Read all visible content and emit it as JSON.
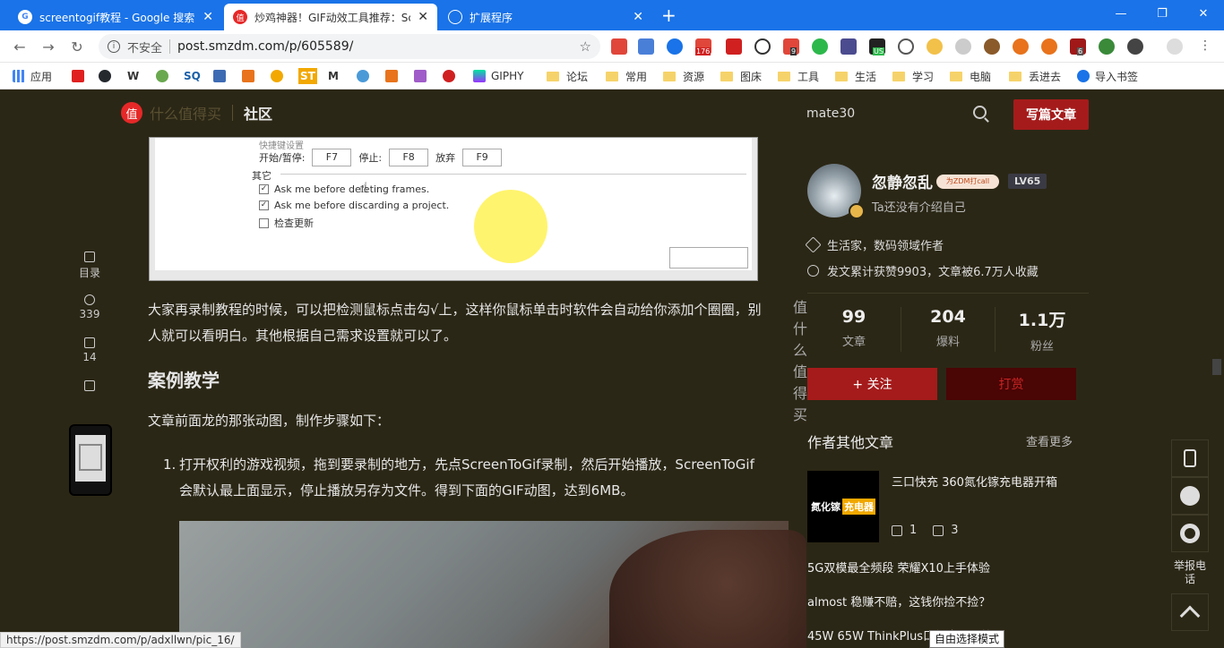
{
  "browser": {
    "tabs": [
      {
        "title": "screentogif教程 - Google 搜索",
        "favicon_color": "#4285f4",
        "icon": "google-icon"
      },
      {
        "title": "炒鸡神器！GIF动效工具推荐：Sc",
        "favicon_color": "#e62828",
        "icon": "smzdm-icon"
      },
      {
        "title": "扩展程序",
        "favicon_color": "#1a73e8",
        "icon": "puzzle-icon"
      }
    ],
    "new_tab_label": "+",
    "close_label": "✕",
    "window_controls": [
      "—",
      "❐",
      "✕"
    ]
  },
  "toolbar": {
    "security_label": "不安全",
    "url": "post.smzdm.com/p/605589/",
    "info_icon": "i",
    "star": "☆"
  },
  "bookmarks": [
    {
      "label": "应用",
      "type": "apps"
    },
    {
      "label": "",
      "type": "icon",
      "color": "#e02020"
    },
    {
      "label": "",
      "type": "icon",
      "color": "#24292e"
    },
    {
      "label": "W",
      "type": "text"
    },
    {
      "label": "",
      "type": "icon",
      "color": "#6aa84f"
    },
    {
      "label": "SQ",
      "type": "text"
    },
    {
      "label": "",
      "type": "icon",
      "color": "#3d6bb3"
    },
    {
      "label": "",
      "type": "icon",
      "color": "#e8731c"
    },
    {
      "label": "",
      "type": "icon",
      "color": "#f2a800"
    },
    {
      "label": "ST",
      "type": "text"
    },
    {
      "label": "M",
      "type": "text"
    },
    {
      "label": "",
      "type": "icon",
      "color": "#4a9ad8"
    },
    {
      "label": "",
      "type": "icon",
      "color": "#e8731c"
    },
    {
      "label": "",
      "type": "icon",
      "color": "#a05cc8"
    },
    {
      "label": "",
      "type": "icon",
      "color": "#d02020"
    },
    {
      "label": "GIPHY",
      "type": "text"
    },
    {
      "label": "论坛",
      "type": "folder"
    },
    {
      "label": "常用",
      "type": "folder"
    },
    {
      "label": "资源",
      "type": "folder"
    },
    {
      "label": "图床",
      "type": "folder"
    },
    {
      "label": "工具",
      "type": "folder"
    },
    {
      "label": "生活",
      "type": "folder"
    },
    {
      "label": "学习",
      "type": "folder"
    },
    {
      "label": "电脑",
      "type": "folder"
    },
    {
      "label": "丢进去",
      "type": "folder"
    },
    {
      "label": "导入书签",
      "type": "gear"
    }
  ],
  "extensions_badges": {
    "e176": "176",
    "e9": "9",
    "eus": "US",
    "e6": "6"
  },
  "site": {
    "logo_mark": "值",
    "logo_name": "什么值得买",
    "community": "社区",
    "search_text": "mate30",
    "write_button": "写篇文章"
  },
  "leftbar": {
    "toc": "目录",
    "favorites": "339",
    "comments": "14"
  },
  "screenshot_inner": {
    "section_title": "快捷键设置",
    "start_pause_label": "开始/暂停:",
    "start_pause_key": "F7",
    "stop_label": "停止:",
    "stop_key": "F8",
    "discard_label": "放弃",
    "discard_key": "F9",
    "other_label": "其它",
    "opt1": "Ask me before deleting frames.",
    "opt2": "Ask me before discarding a project.",
    "opt3": "检查更新",
    "check": "✓",
    "watermark": "值 什么值得买"
  },
  "article": {
    "p1": "大家再录制教程的时候，可以把检测鼠标点击勾√上，这样你鼠标单击时软件会自动给你添加个圈圈，别人就可以看明白。其他根据自己需求设置就可以了。",
    "h3": "案例教学",
    "p2": "文章前面龙的那张动图，制作步骤如下：",
    "li1_num": "1.",
    "li1": "打开权利的游戏视频，拖到要录制的地方，先点ScreenToGif录制，然后开始播放，ScreenToGif会默认最上面显示，停止播放另存为文件。得到下面的GIF动图，达到6MB。"
  },
  "author": {
    "name": "忽静忽乱",
    "tag": "为ZDM打call",
    "level": "LV65",
    "bio": "Ta还没有介绍自己",
    "info1": "生活家，数码领域作者",
    "info2": "发文累计获赞9903，文章被6.7万人收藏",
    "stats": [
      {
        "n": "99",
        "l": "文章"
      },
      {
        "n": "204",
        "l": "爆料"
      },
      {
        "n": "1.1万",
        "l": "粉丝"
      }
    ],
    "follow": "+ 关注",
    "tip": "打赏"
  },
  "other_articles": {
    "title": "作者其他文章",
    "more": "查看更多",
    "thumb_text": "氮化镓",
    "thumb_tag": "充电器",
    "a1_title": "三口快充 360氮化镓充电器开箱",
    "a1_likes": "1",
    "a1_comments": "3",
    "list": [
      "5G双模最全频段  荣耀X10上手体验",
      "almost 稳赚不赔，这钱你捡不捡？",
      "45W 65W ThinkPlus口红电源开箱"
    ]
  },
  "floatbar": {
    "report_text": "举报电话"
  },
  "status": {
    "url": "https://post.smzdm.com/p/adxllwn/pic_16/",
    "tooltip": "自由选择模式"
  }
}
